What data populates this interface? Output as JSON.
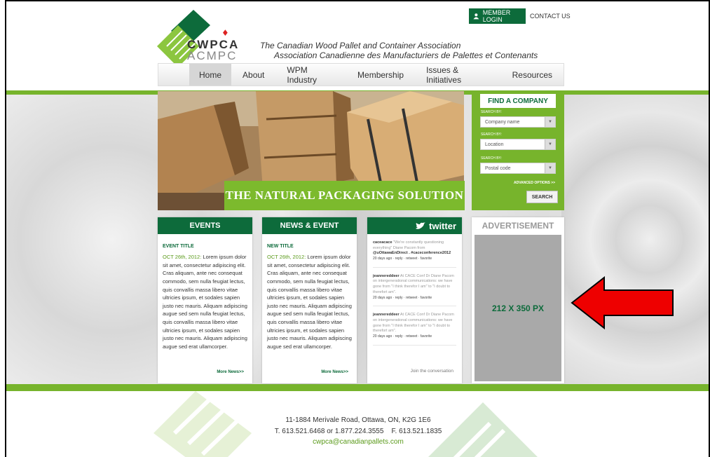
{
  "header": {
    "brand_en": "CWPCA",
    "brand_fr": "ACMPC",
    "tagline_en": "The Canadian Wood Pallet and Container Association",
    "tagline_fr": "Association Canadienne des Manufacturiers de Palettes et Contenants",
    "member_login": "MEMBER LOGIN",
    "contact_us": "CONTACT US"
  },
  "nav": {
    "items": [
      "Home",
      "About",
      "WPM Industry",
      "Membership",
      "Issues & Initiatives",
      "Resources"
    ],
    "active": "Home"
  },
  "hero": {
    "banner": "THE NATURAL PACKAGING SOLUTION"
  },
  "find_company": {
    "title": "FIND A COMPANY",
    "search_by": "SEARCH BY:",
    "fields": [
      "Company name",
      "Location",
      "Postal code"
    ],
    "advanced": "ADVANCED OPTIONS >>",
    "search_button": "SEARCH"
  },
  "events": {
    "title": "EVENTS",
    "subtitle": "EVENT TITLE",
    "date": "OCT 26th, 2012:",
    "text": "Lorem ipsum dolor sit amet, consectetur adipiscing elit. Cras aliquam, ante nec consequat commodo, sem nulla feugiat lectus, quis convallis massa libero vitae ultricies ipsum, et sodales sapien justo nec mauris. Aliquam adipiscing augue sed sem nulla feugiat lectus, quis convallis massa libero vitae ultricies ipsum, et sodales sapien justo nec mauris. Aliquam adipiscing augue sed erat ullamcorper.",
    "more": "More News>>"
  },
  "news": {
    "title": "NEWS & EVENT",
    "subtitle": "NEW TITLE",
    "date": "OCT 26th, 2012:",
    "text": "Lorem ipsum dolor sit amet, consectetur adipiscing elit. Cras aliquam, ante nec consequat commodo, sem nulla feugiat lectus, quis convallis massa libero vitae ultricies ipsum, et sodales sapien justo nec mauris. Aliquam adipiscing augue sed sem nulla feugiat lectus, quis convallis massa libero vitae ultricies ipsum, et sodales sapien justo nec mauris. Aliquam adipiscing augue sed erat ullamcorper.",
    "more": "More News>>"
  },
  "twitter": {
    "title": "twitter",
    "tweets": [
      {
        "user": "caceacace",
        "text": "\"We're constantly questioning everything\" Diane Pacom from",
        "link": "@uOttawaEnDirect . #caceconference2012",
        "meta": "20 days ago · reply · retweet · favorite"
      },
      {
        "user": "jeannereddeer",
        "text": "At CACE Conf Dr Diane Pacom on intergenerational communications: we have gone from \"I think therefor I am\" to \"I doubt to therefort am\".",
        "link": "",
        "meta": "20 days ago · reply · retweet · favorite"
      },
      {
        "user": "jeannereddeer",
        "text": "At CACE Conf Dr Diane Pacom on intergenerational communications: we have gone from \"I think therefor I am\" to \"I doubt to therefort am\".",
        "link": "",
        "meta": "20 days ago · reply · retweet · favorite"
      }
    ],
    "join": "Join the conversation"
  },
  "ad": {
    "title": "ADVERTISEMENT",
    "size": "212 X 350 PX"
  },
  "footer": {
    "address": "11-1884 Merivale Road, Ottawa, ON, K2G 1E6",
    "phone": "T. 613.521.6468 or 1.877.224.3555    F. 613.521.1835",
    "email": "cwpca@canadianpallets.com"
  },
  "colors": {
    "dark_green": "#0d6b3b",
    "lime_green": "#77b42c",
    "arrow_red": "#ee0000"
  }
}
